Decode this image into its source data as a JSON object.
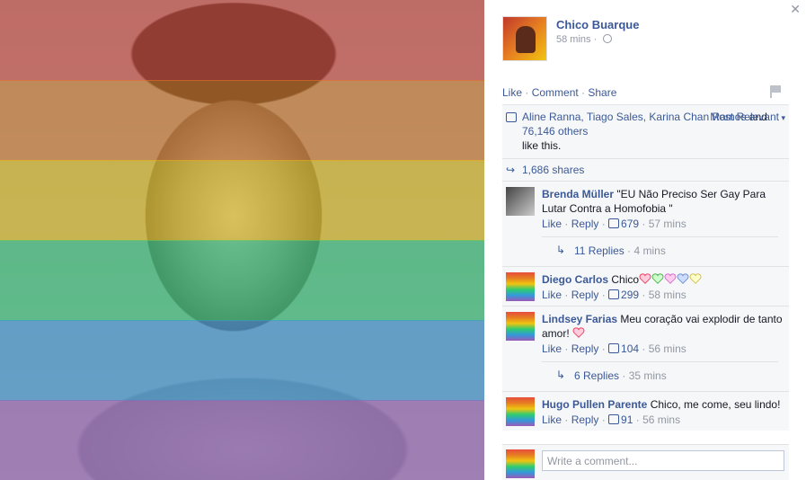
{
  "post": {
    "author": "Chico Buarque",
    "time": "58 mins",
    "actions": {
      "like": "Like",
      "comment": "Comment",
      "share": "Share"
    },
    "likes": {
      "names": "Aline Ranna, Tiago Sales, Karina Chan Ramos",
      "and_text": " and ",
      "others": "76,146 others",
      "suffix": " like this."
    },
    "sort_label": "Most Relevant",
    "shares": "1,686 shares"
  },
  "overlay_colors": [
    "#e74c3c",
    "#e67e22",
    "#f1c40f",
    "#2ecc71",
    "#3498db",
    "#9b59b6"
  ],
  "comments": [
    {
      "name": "Brenda Müller",
      "text": "\"EU Não Preciso Ser Gay Para Lutar Contra a Homofobia \"",
      "like": "Like",
      "reply": "Reply",
      "likes": "679",
      "time": "57 mins",
      "replies": "11 Replies",
      "replies_time": "4 mins"
    },
    {
      "name": "Diego Carlos",
      "text": "Chico",
      "like": "Like",
      "reply": "Reply",
      "likes": "299",
      "time": "58 mins"
    },
    {
      "name": "Lindsey Farias",
      "text": "Meu coração vai explodir de tanto amor! ",
      "like": "Like",
      "reply": "Reply",
      "likes": "104",
      "time": "56 mins",
      "replies": "6 Replies",
      "replies_time": "35 mins"
    },
    {
      "name": "Hugo Pullen Parente",
      "text": "Chico, me come, seu lindo!",
      "like": "Like",
      "reply": "Reply",
      "likes": "91",
      "time": "56 mins"
    }
  ],
  "write_comment": {
    "placeholder": "Write a comment..."
  },
  "sep": " · "
}
